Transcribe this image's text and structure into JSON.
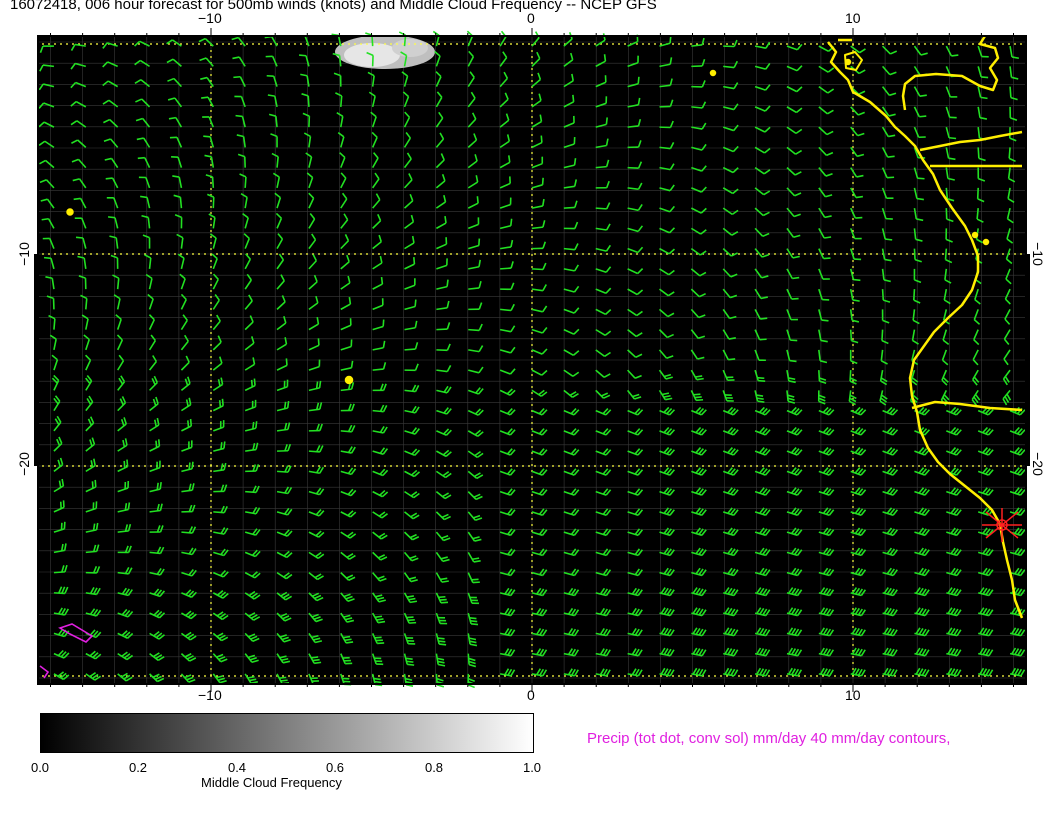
{
  "title": "16072418, 006 hour forecast for 500mb winds (knots) and Middle Cloud Frequency -- NCEP GFS",
  "axes": {
    "top_labels": [
      "−10",
      "0",
      "10"
    ],
    "bottom_labels": [
      "−10",
      "0",
      "10"
    ],
    "left_labels": [
      "−10",
      "−20"
    ],
    "right_labels": [
      "−10",
      "−20"
    ]
  },
  "colorbar": {
    "label": "Middle Cloud Frequency",
    "ticks": [
      "0.0",
      "0.2",
      "0.4",
      "0.6",
      "0.8",
      "1.0"
    ]
  },
  "precip_note": "Precip (tot dot, conv sol) mm/day 40 mm/day contours,",
  "colors": {
    "background": "#000000",
    "wind_barbs": "#22e022",
    "coastline": "#ffee00",
    "grid": "#ffff44",
    "precip_contour": "#e020e0",
    "marker": "#ff2020"
  },
  "map_extent": {
    "lon_range": [
      -15.5,
      15.5
    ],
    "lat_range": [
      -29.5,
      0.5
    ]
  }
}
